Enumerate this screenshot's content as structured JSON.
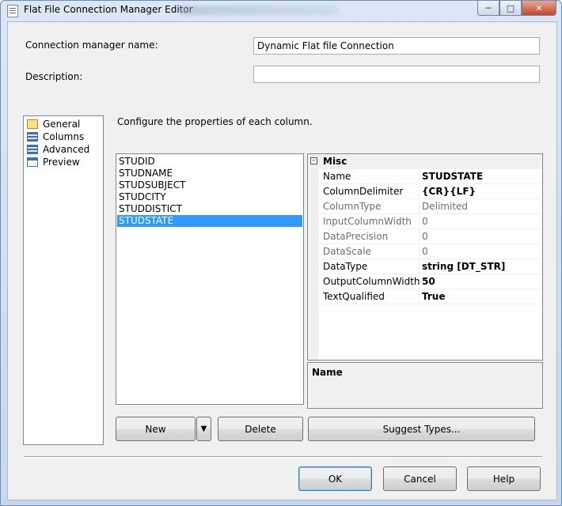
{
  "window": {
    "title": "Flat File Connection Manager Editor",
    "icon": "document-icon",
    "controls": [
      "minimize",
      "maximize",
      "close"
    ]
  },
  "form": {
    "conn_name_label": "Connection manager name:",
    "conn_name_value": "Dynamic Flat file Connection",
    "description_label": "Description:",
    "description_value": ""
  },
  "nav": {
    "items": [
      {
        "label": "General",
        "icon": "general-icon"
      },
      {
        "label": "Columns",
        "icon": "columns-icon"
      },
      {
        "label": "Advanced",
        "icon": "advanced-icon"
      },
      {
        "label": "Preview",
        "icon": "preview-icon"
      }
    ]
  },
  "main": {
    "instruction": "Configure the properties of each column.",
    "columns": [
      "STUDID",
      "STUDNAME",
      "STUDSUBJECT",
      "STUDCITY",
      "STUDDISTICT",
      "STUDSTATE"
    ],
    "selected_column": "STUDSTATE"
  },
  "properties": {
    "category": "Misc",
    "rows": [
      {
        "name": "Name",
        "value": "STUDSTATE",
        "state": "bold"
      },
      {
        "name": "ColumnDelimiter",
        "value": "{CR}{LF}",
        "state": "bold"
      },
      {
        "name": "ColumnType",
        "value": "Delimited",
        "state": "disabled"
      },
      {
        "name": "InputColumnWidth",
        "value": "0",
        "state": "disabled"
      },
      {
        "name": "DataPrecision",
        "value": "0",
        "state": "disabled"
      },
      {
        "name": "DataScale",
        "value": "0",
        "state": "disabled"
      },
      {
        "name": "DataType",
        "value": "string [DT_STR]",
        "state": "bold"
      },
      {
        "name": "OutputColumnWidth",
        "value": "50",
        "state": "bold"
      },
      {
        "name": "TextQualified",
        "value": "True",
        "state": "bold"
      }
    ],
    "description_title": "Name"
  },
  "buttons": {
    "new": "New",
    "delete": "Delete",
    "suggest": "Suggest Types...",
    "ok": "OK",
    "cancel": "Cancel",
    "help": "Help"
  }
}
